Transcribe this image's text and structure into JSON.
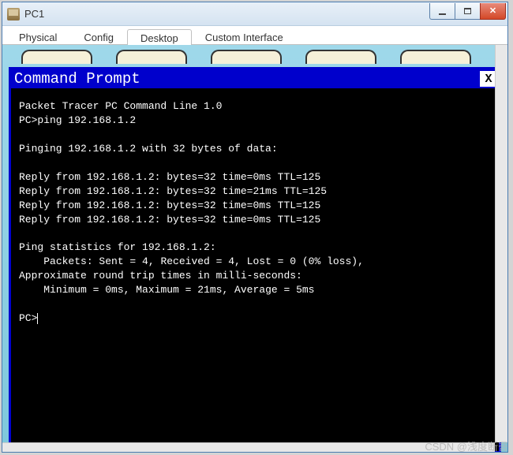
{
  "window": {
    "title": "PC1"
  },
  "tabs": {
    "items": [
      {
        "label": "Physical",
        "active": false
      },
      {
        "label": "Config",
        "active": false
      },
      {
        "label": "Desktop",
        "active": true
      },
      {
        "label": "Custom Interface",
        "active": false
      }
    ]
  },
  "prompt": {
    "title": "Command Prompt",
    "close_label": "X"
  },
  "terminal": {
    "header": "Packet Tracer PC Command Line 1.0",
    "command_line": "PC>ping 192.168.1.2",
    "pinging": "Pinging 192.168.1.2 with 32 bytes of data:",
    "replies": [
      "Reply from 192.168.1.2: bytes=32 time=0ms TTL=125",
      "Reply from 192.168.1.2: bytes=32 time=21ms TTL=125",
      "Reply from 192.168.1.2: bytes=32 time=0ms TTL=125",
      "Reply from 192.168.1.2: bytes=32 time=0ms TTL=125"
    ],
    "stats_header": "Ping statistics for 192.168.1.2:",
    "packets": "    Packets: Sent = 4, Received = 4, Lost = 0 (0% loss),",
    "approx": "Approximate round trip times in milli-seconds:",
    "times": "    Minimum = 0ms, Maximum = 21ms, Average = 5ms",
    "next_prompt": "PC>"
  },
  "watermark": "CSDN @浅度断罾"
}
